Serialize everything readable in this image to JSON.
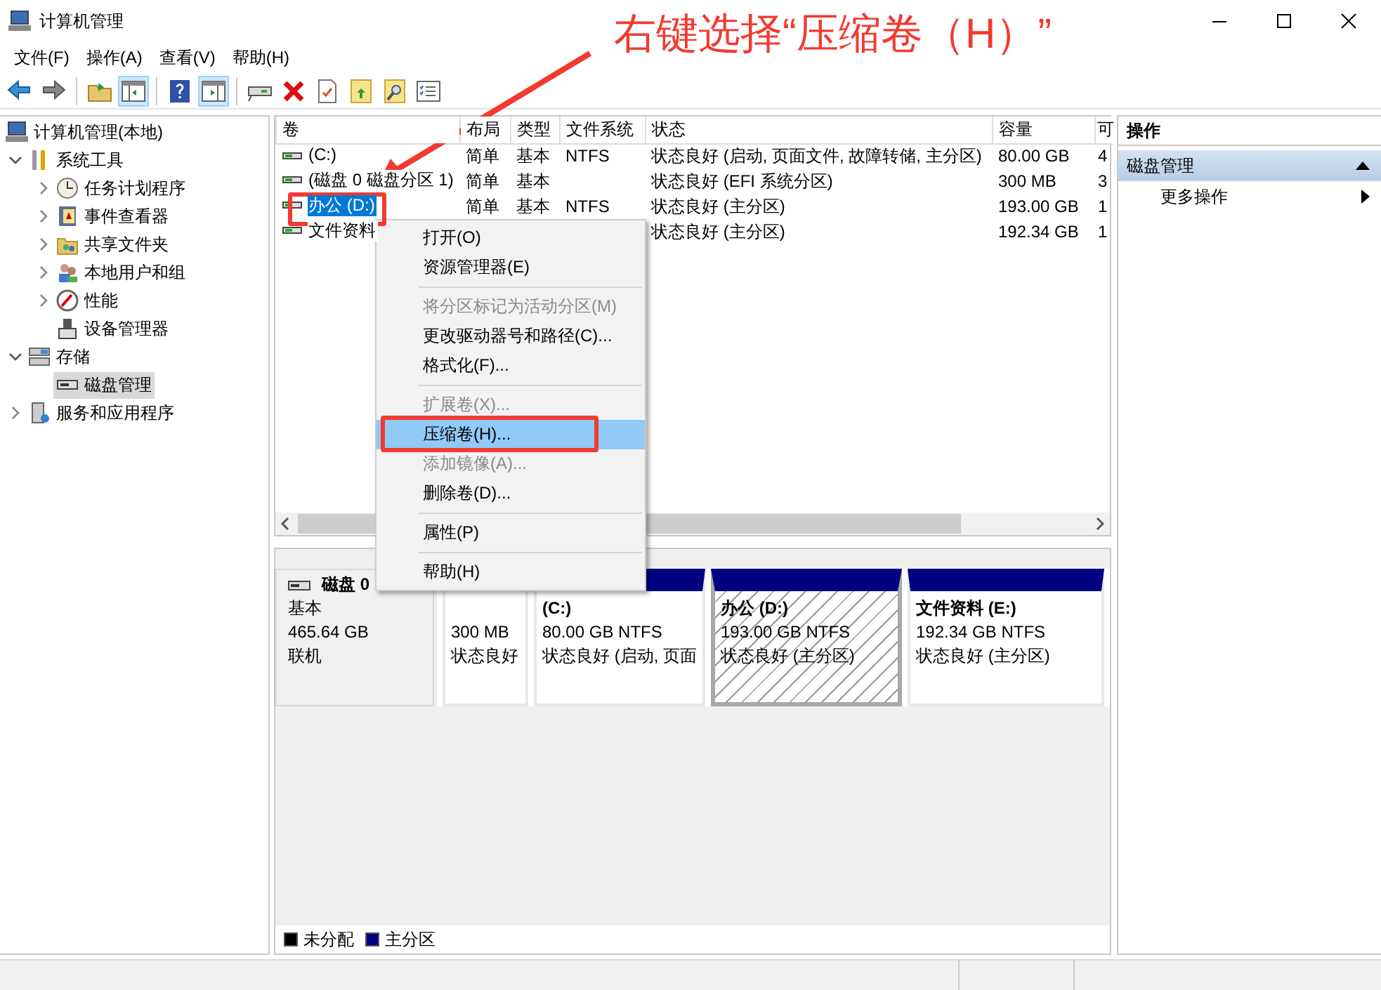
{
  "window": {
    "title": "计算机管理"
  },
  "annotation": {
    "text": "右键选择“压缩卷（H）”"
  },
  "menu": [
    "文件(F)",
    "操作(A)",
    "查看(V)",
    "帮助(H)"
  ],
  "toolbar": [
    {
      "on": false
    },
    {
      "on": false
    },
    {
      "on": false
    },
    {
      "on": true
    },
    {
      "on": false
    },
    {
      "on": true
    },
    {
      "on": false
    },
    {
      "on": false
    },
    {
      "on": false
    },
    {
      "on": false
    },
    {
      "on": false
    },
    {
      "on": false
    }
  ],
  "tree": {
    "label": "计算机管理(本地)",
    "selected": false,
    "children": [
      {
        "label": "系统工具",
        "expanded": true,
        "selected": false,
        "children": [
          {
            "label": "任务计划程序",
            "expanded": false,
            "selected": false
          },
          {
            "label": "事件查看器",
            "expanded": false,
            "selected": false
          },
          {
            "label": "共享文件夹",
            "expanded": false,
            "selected": false
          },
          {
            "label": "本地用户和组",
            "expanded": false,
            "selected": false
          },
          {
            "label": "性能",
            "expanded": false,
            "selected": false
          },
          {
            "label": "设备管理器",
            "selected": false
          }
        ]
      },
      {
        "label": "存储",
        "expanded": true,
        "selected": false,
        "children": [
          {
            "label": "磁盘管理",
            "selected": true
          }
        ]
      },
      {
        "label": "服务和应用程序",
        "expanded": false,
        "selected": false
      }
    ]
  },
  "table": {
    "columns": [
      "卷",
      "布局",
      "类型",
      "文件系统",
      "状态",
      "容量",
      "可"
    ],
    "rows": [
      {
        "volume": "(C:)",
        "layout": "简单",
        "type": "基本",
        "file_system": "NTFS",
        "status": "状态良好 (启动, 页面文件, 故障转储, 主分区)",
        "capacity": "80.00 GB",
        "column_7": "4",
        "selected": false
      },
      {
        "volume": "(磁盘 0 磁盘分区 1)",
        "layout": "简单",
        "type": "基本",
        "status": "状态良好 (EFI 系统分区)",
        "capacity": "300 MB",
        "column_7": "3",
        "selected": false
      },
      {
        "volume": "办公 (D:)",
        "layout": "简单",
        "type": "基本",
        "file_system": "NTFS",
        "status": "状态良好 (主分区)",
        "capacity": "193.00 GB",
        "column_7": "1",
        "selected": true
      },
      {
        "volume": "文件资料",
        "status": "状态良好 (主分区)",
        "capacity": "192.34 GB",
        "column_7": "1",
        "selected": false
      }
    ]
  },
  "disks": [
    {
      "name": "磁盘 0",
      "type": "基本",
      "size": "465.64 GB",
      "state": "联机",
      "partitions": [
        {
          "size": "300 MB",
          "status": "状态良好",
          "selected": false
        },
        {
          "title": "(C:)",
          "size": "80.00 GB NTFS",
          "status": "状态良好 (启动, 页面",
          "selected": false
        },
        {
          "title": "办公 (D:)",
          "size": "193.00 GB NTFS",
          "status": "状态良好 (主分区)",
          "selected": true
        },
        {
          "title": "文件资料 (E:)",
          "size": "192.34 GB NTFS",
          "status": "状态良好 (主分区)",
          "selected": false
        }
      ]
    }
  ],
  "legend": [
    {
      "label": "未分配",
      "color": "#000000"
    },
    {
      "label": "主分区",
      "color": "#000080"
    }
  ],
  "actions": {
    "title": "操作",
    "sections": [
      {
        "label": "磁盘管理",
        "expanded": true,
        "items": [
          {
            "label": "更多操作"
          }
        ]
      }
    ]
  },
  "context_menu": [
    {
      "kind": "item",
      "label": "打开(O)",
      "disabled": false,
      "selected": false
    },
    {
      "kind": "item",
      "label": "资源管理器(E)",
      "disabled": false,
      "selected": false
    },
    {
      "kind": "separator"
    },
    {
      "kind": "item",
      "label": "将分区标记为活动分区(M)",
      "disabled": true,
      "selected": false
    },
    {
      "kind": "item",
      "label": "更改驱动器号和路径(C)...",
      "disabled": false,
      "selected": false
    },
    {
      "kind": "item",
      "label": "格式化(F)...",
      "disabled": false,
      "selected": false
    },
    {
      "kind": "separator"
    },
    {
      "kind": "item",
      "label": "扩展卷(X)...",
      "disabled": true,
      "selected": false
    },
    {
      "kind": "item",
      "label": "压缩卷(H)...",
      "disabled": false,
      "selected": true
    },
    {
      "kind": "item",
      "label": "添加镜像(A)...",
      "disabled": true,
      "selected": false
    },
    {
      "kind": "item",
      "label": "删除卷(D)...",
      "disabled": false,
      "selected": false
    },
    {
      "kind": "separator"
    },
    {
      "kind": "item",
      "label": "属性(P)",
      "disabled": false,
      "selected": false
    },
    {
      "kind": "separator"
    },
    {
      "kind": "item",
      "label": "帮助(H)",
      "disabled": false,
      "selected": false
    }
  ]
}
